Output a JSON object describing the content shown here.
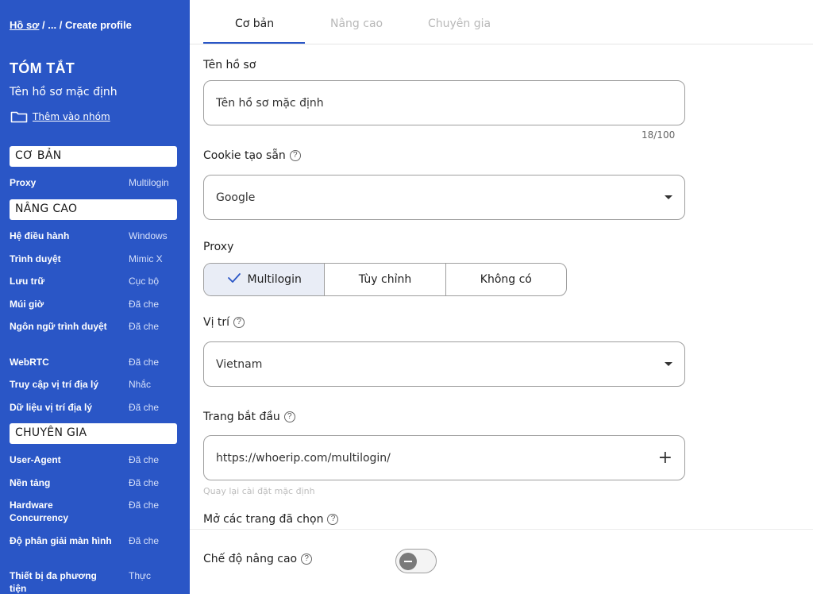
{
  "breadcrumb": {
    "root": "Hồ sơ",
    "ellipsis": "...",
    "current": "Create profile",
    "sep": "/"
  },
  "summary": {
    "title": "TÓM TẮT",
    "profile_name": "Tên hồ sơ mặc định",
    "add_group": "Thêm vào nhóm",
    "sections": {
      "basic": "CƠ BẢN",
      "advanced": "NÂNG CAO",
      "expert": "CHUYÊN GIA"
    },
    "basic_rows": [
      {
        "key": "Proxy",
        "value": "Multilogin"
      }
    ],
    "advanced_rows": [
      {
        "key": "Hệ điều hành",
        "value": "Windows"
      },
      {
        "key": "Trình duyệt",
        "value": "Mimic X"
      },
      {
        "key": "Lưu trữ",
        "value": "Cục bộ"
      },
      {
        "key": "Múi giờ",
        "value": "Đã che"
      },
      {
        "key": "Ngôn ngữ trình duyệt",
        "value": "Đã che"
      },
      {
        "key": "WebRTC",
        "value": "Đã che"
      },
      {
        "key": "Truy cập vị trí địa lý",
        "value": "Nhắc"
      },
      {
        "key": "Dữ liệu vị trí địa lý",
        "value": "Đã che"
      }
    ],
    "expert_rows": [
      {
        "key": "User-Agent",
        "value": "Đã che"
      },
      {
        "key": "Nền tảng",
        "value": "Đã che"
      },
      {
        "key": "Hardware Concurrency",
        "value": "Đã che"
      },
      {
        "key": "Độ phân giải màn hình",
        "value": "Đã che"
      },
      {
        "key": "Thiết bị đa phương tiện",
        "value": "Thực"
      }
    ]
  },
  "tabs": [
    {
      "label": "Cơ bản",
      "active": true
    },
    {
      "label": "Nâng cao",
      "active": false
    },
    {
      "label": "Chuyên gia",
      "active": false
    }
  ],
  "form": {
    "profile_name_label": "Tên hồ sơ",
    "profile_name_value": "Tên hồ sơ mặc định",
    "profile_name_counter": "18/100",
    "cookie_label": "Cookie tạo sẵn",
    "cookie_value": "Google",
    "proxy_label": "Proxy",
    "proxy_options": [
      "Multilogin",
      "Tùy chỉnh",
      "Không có"
    ],
    "proxy_selected": "Multilogin",
    "location_label": "Vị trí",
    "location_value": "Vietnam",
    "start_page_label": "Trang bắt đầu",
    "start_page_value": "https://whoerip.com/multilogin/",
    "reset_hint": "Quay lại cài đặt mặc định",
    "open_selected_label": "Mở các trang đã chọn",
    "advanced_mode_label": "Chế độ nâng cao",
    "advanced_mode_on": false
  },
  "colors": {
    "sidebar": "#2a56c6",
    "accent": "#2a56c6"
  }
}
